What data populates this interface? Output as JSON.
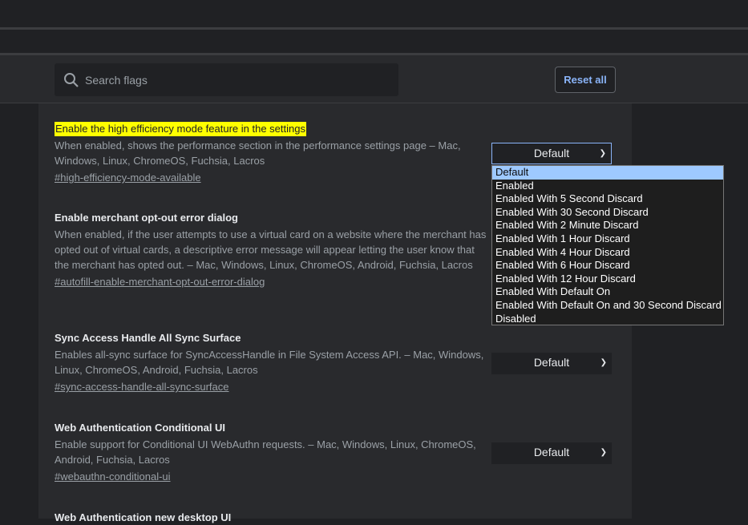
{
  "search": {
    "placeholder": "Search flags"
  },
  "reset_label": "Reset all",
  "flags": [
    {
      "title": "Enable the high efficiency mode feature in the settings",
      "desc": "When enabled, shows the performance section in the performance settings page – Mac, Windows, Linux, ChromeOS, Fuchsia, Lacros",
      "link": "#high-efficiency-mode-available",
      "select": "Default"
    },
    {
      "title": "Enable merchant opt-out error dialog",
      "desc": "When enabled, if the user attempts to use a virtual card on a website where the merchant has opted out of virtual cards, a descriptive error message will appear letting the user know that the merchant has opted out. – Mac, Windows, Linux, ChromeOS, Android, Fuchsia, Lacros",
      "link": "#autofill-enable-merchant-opt-out-error-dialog",
      "select": ""
    },
    {
      "title": "Sync Access Handle All Sync Surface",
      "desc": "Enables all-sync surface for SyncAccessHandle in File System Access API. – Mac, Windows, Linux, ChromeOS, Android, Fuchsia, Lacros",
      "link": "#sync-access-handle-all-sync-surface",
      "select": "Default"
    },
    {
      "title": "Web Authentication Conditional UI",
      "desc": "Enable support for Conditional UI WebAuthn requests. – Mac, Windows, Linux, ChromeOS, Android, Fuchsia, Lacros",
      "link": "#webauthn-conditional-ui",
      "select": "Default"
    },
    {
      "title": "Web Authentication new desktop UI"
    }
  ],
  "dropdown": {
    "selected": "Default",
    "options": [
      "Default",
      "Enabled",
      "Enabled With 5 Second Discard",
      "Enabled With 30 Second Discard",
      "Enabled With 2 Minute Discard",
      "Enabled With 1 Hour Discard",
      "Enabled With 4 Hour Discard",
      "Enabled With 6 Hour Discard",
      "Enabled With 12 Hour Discard",
      "Enabled With Default On",
      "Enabled With Default On and 30 Second Discard",
      "Disabled"
    ]
  },
  "colors": {
    "highlight": "#ffff00",
    "accent": "#8ab4f8",
    "dropdown_selected": "#9ec9ff"
  }
}
